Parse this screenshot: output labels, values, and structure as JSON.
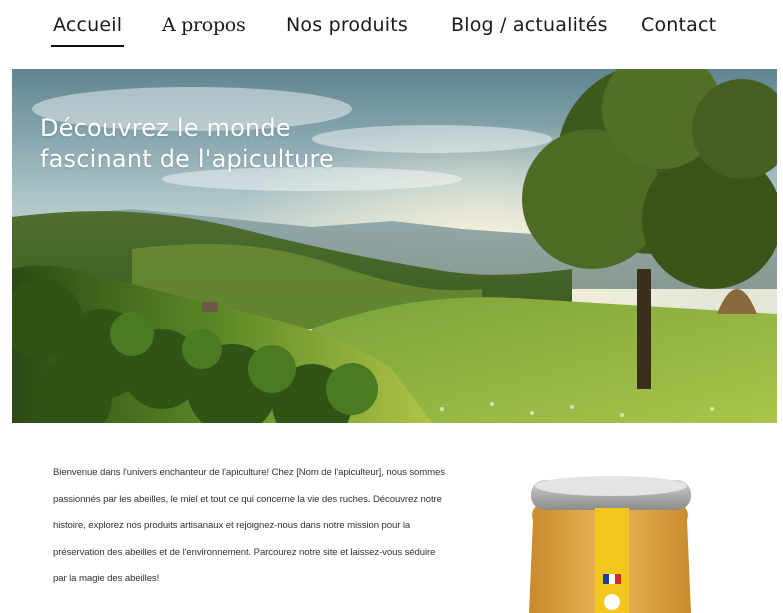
{
  "nav": {
    "items": [
      {
        "label": "Accueil",
        "active": true
      },
      {
        "label": "A propos",
        "active": false
      },
      {
        "label": "Nos produits",
        "active": false
      },
      {
        "label": "Blog / actualités",
        "active": false
      },
      {
        "label": "Contact",
        "active": false
      }
    ]
  },
  "hero": {
    "title": "Découvrez le monde fascinant de l'apiculture"
  },
  "intro": {
    "text": "Bienvenue dans l'univers enchanteur de l'apiculture! Chez [Nom de l'apiculteur], nous sommes passionnés par les abeilles, le miel et tout ce qui concerne la vie des ruches. Découvrez notre histoire, explorez nos produits artisanaux et rejoignez-nous dans notre mission pour la préservation des abeilles et de l'environnement. Parcourez notre site et laissez-vous séduire par la magie des abeilles!"
  },
  "colors": {
    "accent": "#111111",
    "honey": "#e8b24a",
    "label_yellow": "#f3c81e"
  }
}
